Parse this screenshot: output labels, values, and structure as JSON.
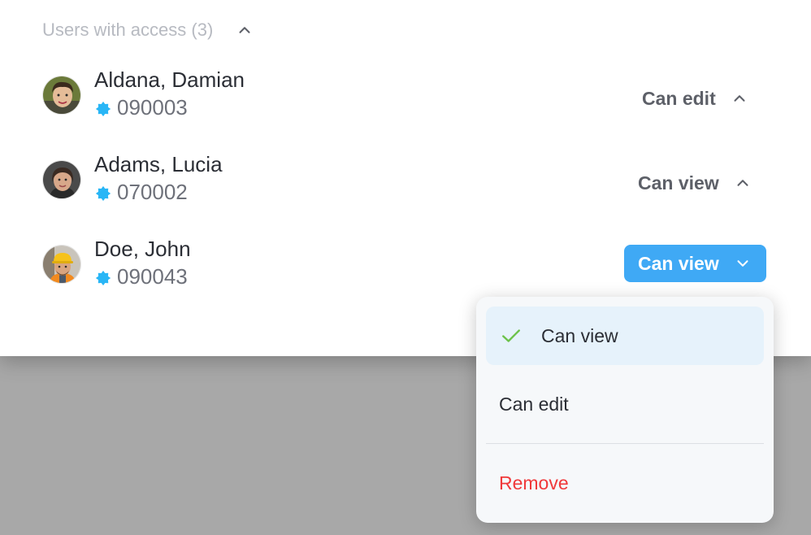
{
  "section": {
    "title": "Users with access (3)",
    "icon": "chevron-up-icon"
  },
  "users": [
    {
      "name": "Aldana, Damian",
      "id": "090003",
      "permission": "Can edit",
      "chevron": "up"
    },
    {
      "name": "Adams, Lucia",
      "id": "070002",
      "permission": "Can view",
      "chevron": "up"
    },
    {
      "name": "Doe, John",
      "id": "090043",
      "permission": "Can view",
      "chevron": "down",
      "active": true
    }
  ],
  "dropdown": {
    "options": [
      {
        "label": "Can view",
        "selected": true
      },
      {
        "label": "Can edit",
        "selected": false
      }
    ],
    "remove_label": "Remove"
  },
  "colors": {
    "accent": "#3fa9f5",
    "badge": "#29b6f6",
    "check": "#6cc24a",
    "danger": "#f0393a",
    "selected_bg": "#e6f2fb"
  }
}
